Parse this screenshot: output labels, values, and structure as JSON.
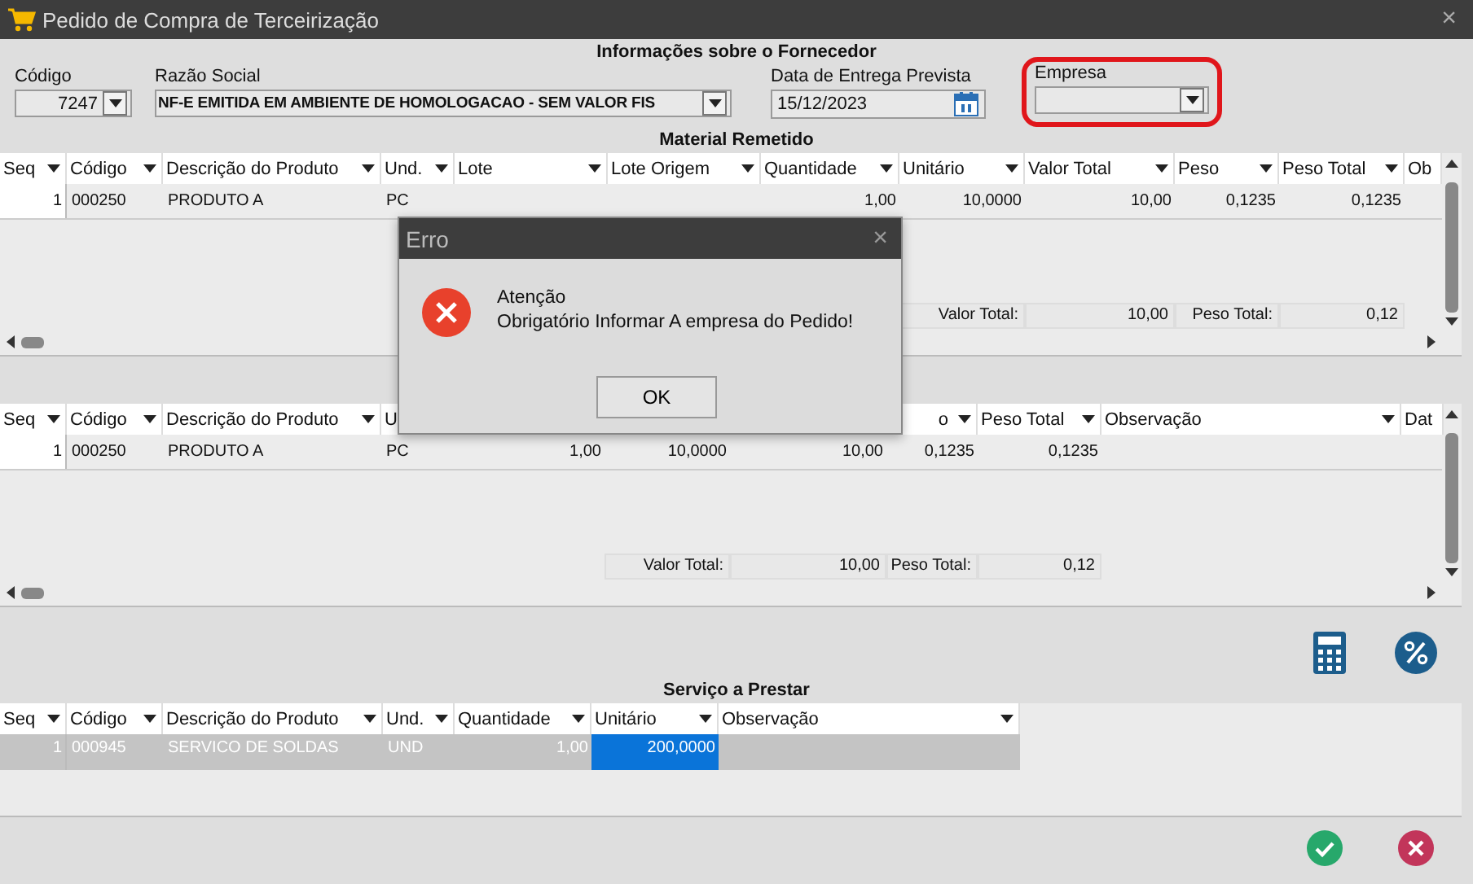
{
  "window": {
    "title": "Pedido de Compra de Terceirização",
    "close": "×"
  },
  "supplier": {
    "heading": "Informações sobre o Fornecedor",
    "fields": [
      {
        "label": "Código",
        "value": "7247",
        "kind": "combo",
        "highlighted": false
      },
      {
        "label": "Razão Social",
        "value": "NF-E EMITIDA EM AMBIENTE DE HOMOLOGACAO - SEM VALOR FIS",
        "kind": "combo",
        "highlighted": false
      },
      {
        "label": "Data de Entrega Prevista",
        "value": "15/12/2023",
        "kind": "date",
        "highlighted": false
      },
      {
        "label": "Empresa",
        "kind": "combo",
        "highlighted": true
      }
    ]
  },
  "material_sent": {
    "heading": "Material Remetido",
    "columns": [
      {
        "label": "Seq",
        "menu": true
      },
      {
        "label": "Código",
        "menu": true
      },
      {
        "label": "Descrição do Produto",
        "menu": true
      },
      {
        "label": "Und.",
        "menu": true
      },
      {
        "label": "Lote",
        "menu": true
      },
      {
        "label": "Lote Origem",
        "menu": true
      },
      {
        "label": "Quantidade",
        "menu": true
      },
      {
        "label": "Unitário",
        "menu": true
      },
      {
        "label": "Valor Total",
        "menu": true
      },
      {
        "label": "Peso",
        "menu": true
      },
      {
        "label": "Peso Total",
        "menu": true
      },
      {
        "label": "Ob",
        "menu": false
      }
    ],
    "rows": [
      {
        "cells": [
          "1",
          "000250",
          "PRODUTO A",
          "PC",
          null,
          null,
          "1,00",
          "10,0000",
          "10,00",
          "0,1235",
          "0,1235",
          null
        ]
      }
    ],
    "totals": [
      {
        "label": "Valor Total:",
        "value": "10,00"
      },
      {
        "label": "Peso Total:",
        "value": "0,12"
      }
    ]
  },
  "second_grid": {
    "columns": [
      {
        "label": "Seq",
        "menu": true
      },
      {
        "label": "Código",
        "menu": true
      },
      {
        "label": "Descrição do Produto",
        "menu": true
      },
      {
        "label": "U"
      },
      {},
      {},
      {},
      {
        "label": "o",
        "menu": true
      },
      {
        "label": "Peso Total",
        "menu": true
      },
      {
        "label": "Observação",
        "menu": true
      },
      {
        "label": "Dat",
        "menu": false
      }
    ],
    "rows": [
      {
        "cells": [
          "1",
          "000250",
          "PRODUTO A",
          "PC",
          "1,00",
          "10,0000",
          "10,00",
          "0,1235",
          "0,1235",
          null,
          null
        ]
      }
    ],
    "totals": [
      {
        "label": "Valor Total:",
        "value": "10,00"
      },
      {
        "label": "Peso Total:",
        "value": "0,12"
      }
    ]
  },
  "tools": [
    {
      "kind": "calculator"
    },
    {
      "kind": "percent"
    }
  ],
  "service": {
    "heading": "Serviço a Prestar",
    "columns": [
      {
        "label": "Seq",
        "menu": true
      },
      {
        "label": "Código",
        "menu": true
      },
      {
        "label": "Descrição do Produto",
        "menu": true
      },
      {
        "label": "Und.",
        "menu": true
      },
      {
        "label": "Quantidade",
        "menu": true
      },
      {
        "label": "Unitário",
        "menu": true
      },
      {
        "label": "Observação",
        "menu": true
      }
    ],
    "rows": [
      {
        "selected": true,
        "cells": [
          {
            "text": "1",
            "selected": false
          },
          {
            "text": "000945",
            "selected": false
          },
          {
            "text": "SERVICO DE SOLDAS",
            "selected": false
          },
          {
            "text": "UND",
            "selected": false
          },
          {
            "text": "1,00",
            "selected": false
          },
          {
            "text": "200,0000",
            "selected": true
          },
          {
            "selected": false
          }
        ]
      }
    ]
  },
  "actions": [
    {
      "kind": "confirm"
    },
    {
      "kind": "cancel"
    }
  ],
  "dialog": {
    "title": "Erro",
    "close": "×",
    "heading": "Atenção",
    "message": "Obrigatório Informar A empresa do Pedido!",
    "button": "OK"
  }
}
